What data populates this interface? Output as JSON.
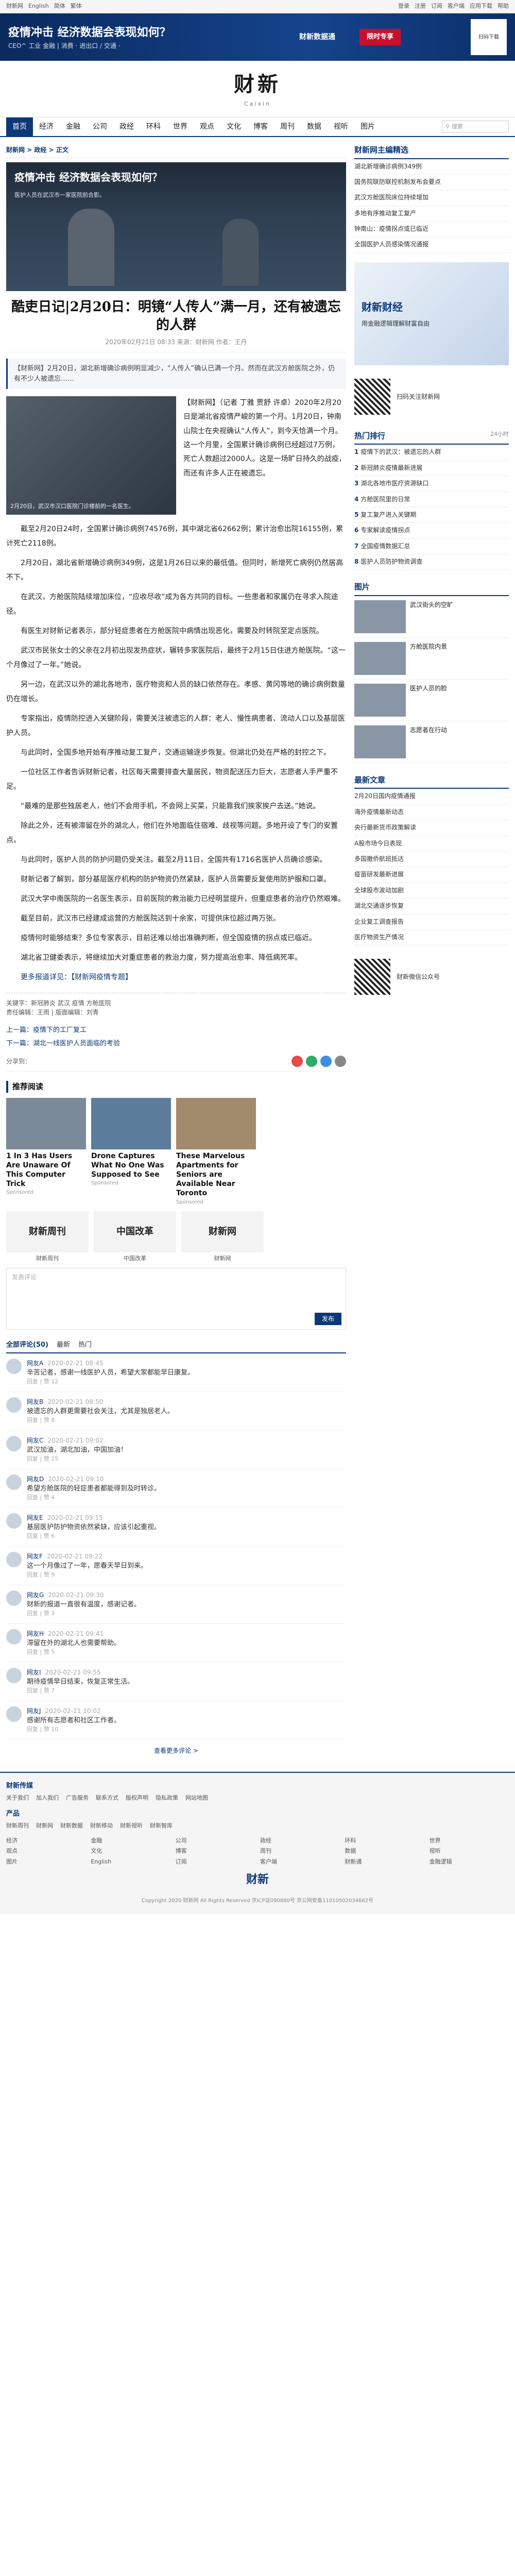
{
  "topbar": {
    "left": [
      "财新网",
      "English",
      "简体",
      "繁体"
    ],
    "right": [
      "登录",
      "注册",
      "订阅",
      "客户端",
      "应用下载",
      "帮助"
    ]
  },
  "banner": {
    "title": "疫情冲击 经济数据会表现如何？",
    "sub": "CEO^ 工业 金融 | 消费 · 进出口 / 交通 ·",
    "mid": "财新数据通",
    "btn": "限时专享",
    "qr": "扫码下载"
  },
  "header": {
    "logo": "财新",
    "sub": "Caixin"
  },
  "nav": {
    "items": [
      "首页",
      "经济",
      "金融",
      "公司",
      "政经",
      "环科",
      "世界",
      "观点",
      "文化",
      "博客",
      "周刊",
      "数据",
      "视听",
      "图片",
      "财新通"
    ],
    "search": "搜索"
  },
  "crumb": {
    "label": "财新网 > 政经 > 正文"
  },
  "hero": {
    "head": "疫情冲击 经济数据会表现如何？",
    "cap": "医护人员在武汉市一家医院前合影。"
  },
  "article": {
    "title": "酷吏日记|2月20日：明镜“人传人”满一月，还有被遗忘的人群",
    "meta": "2020年02月21日 08:33  来源：财新网  作者：王丹",
    "summary": "【财新网】2月20日，湖北新增确诊病例明显减少，“人传人”确认已满一个月。然而在武汉方舱医院之外，仍有不少人被遗忘……",
    "photo_cap": "2月20日，武汉市汉口医院门诊楼前的一名医生。",
    "photo_text": "【财新网】（记者 丁雅 贾舒 许卓）2020年2月20日是湖北省疫情严峻的第一个月。1月20日，钟南山院士在央视确认“人传人”，到今天恰满一个月。这一个月里，全国累计确诊病例已经超过7万例，死亡人数超过2000人。这是一场旷日持久的战疫，而还有许多人正在被遗忘。",
    "paragraphs": [
      "截至2月20日24时，全国累计确诊病例74576例，其中湖北省62662例；累计治愈出院16155例，累计死亡2118例。",
      "2月20日，湖北省新增确诊病例349例，这是1月26日以来的最低值。但同时，新增死亡病例仍然居高不下。",
      "在武汉，方舱医院陆续增加床位，“应收尽收”成为各方共同的目标。一些患者和家属仍在寻求入院途径。",
      "有医生对财新记者表示，部分轻症患者在方舱医院中病情出现恶化，需要及时转院至定点医院。",
      "武汉市民张女士的父亲在2月初出现发热症状，辗转多家医院后，最终于2月15日住进方舱医院。“这一个月像过了一年。”她说。",
      "另一边，在武汉以外的湖北各地市，医疗物资和人员的缺口依然存在。孝感、黄冈等地的确诊病例数量仍在增长。",
      "专家指出，疫情防控进入关键阶段，需要关注被遗忘的人群：老人、慢性病患者、流动人口以及基层医护人员。",
      "与此同时，全国多地开始有序推动复工复产，交通运输逐步恢复。但湖北仍处在严格的封控之下。",
      "一位社区工作者告诉财新记者，社区每天需要排查大量居民，物资配送压力巨大，志愿者人手严重不足。",
      "“最难的是那些独居老人，他们不会用手机，不会网上买菜，只能靠我们挨家挨户去送。”她说。",
      "除此之外，还有被滞留在外的湖北人，他们在外地面临住宿难、歧视等问题。多地开设了专门的安置点。",
      "与此同时，医护人员的防护问题仍受关注。截至2月11日，全国共有1716名医护人员确诊感染。",
      "财新记者了解到，部分基层医疗机构的防护物资仍然紧缺，医护人员需要反复使用防护服和口罩。",
      "武汉大学中南医院的一名医生表示，目前医院的救治能力已经明显提升，但重症患者的治疗仍然艰难。",
      "截至目前，武汉市已经建成运营的方舱医院达到十余家，可提供床位超过两万张。",
      "疫情何时能够结束？多位专家表示，目前还难以给出准确判断，但全国疫情的拐点或已临近。",
      "湖北省卫健委表示，将继续加大对重症患者的救治力度，努力提高治愈率、降低病死率。"
    ],
    "note": "更多报道详见：【财新网疫情专题】",
    "tags": "关键字：新冠肺炎 武汉 疫情 方舱医院",
    "editor": "责任编辑：王雨 | 版面编辑：刘青",
    "prev": "上一篇：疫情下的工厂复工",
    "next": "下一篇：湖北一线医护人员面临的考验"
  },
  "share": {
    "label": "分享到："
  },
  "related": {
    "title": "推荐阅读",
    "items": [
      {
        "t": "1 In 3 Has Users Are Unaware Of This Computer Trick",
        "s": "Sponsored"
      },
      {
        "t": "Drone Captures What No One Was Supposed to See",
        "s": "Sponsored"
      },
      {
        "t": "These Marvelous Apartments for Seniors are Available Near Toronto",
        "s": "Sponsored"
      }
    ]
  },
  "logos": [
    {
      "n": "财新周刊",
      "c": "财新周刊"
    },
    {
      "n": "中国改革",
      "c": "中国改革"
    },
    {
      "n": "财新网",
      "c": "财新网"
    }
  ],
  "comment": {
    "box_ph": "发表评论",
    "send": "发布",
    "tabs": [
      "全部评论(50)",
      "最新",
      "热门"
    ],
    "items": [
      {
        "n": "网友A",
        "t": "2020-02-21 08:45",
        "b": "辛苦记者，感谢一线医护人员，希望大家都能早日康复。",
        "f": "回复 | 赞 12"
      },
      {
        "n": "网友B",
        "t": "2020-02-21 08:50",
        "b": "被遗忘的人群更需要社会关注，尤其是独居老人。",
        "f": "回复 | 赞 8"
      },
      {
        "n": "网友C",
        "t": "2020-02-21 09:02",
        "b": "武汉加油，湖北加油，中国加油！",
        "f": "回复 | 赞 15"
      },
      {
        "n": "网友D",
        "t": "2020-02-21 09:10",
        "b": "希望方舱医院的轻症患者都能得到及时转诊。",
        "f": "回复 | 赞 4"
      },
      {
        "n": "网友E",
        "t": "2020-02-21 09:15",
        "b": "基层医护防护物资依然紧缺，应该引起重视。",
        "f": "回复 | 赞 6"
      },
      {
        "n": "网友F",
        "t": "2020-02-21 09:22",
        "b": "这一个月像过了一年，愿春天早日到来。",
        "f": "回复 | 赞 9"
      },
      {
        "n": "网友G",
        "t": "2020-02-21 09:30",
        "b": "财新的报道一直很有温度，感谢记者。",
        "f": "回复 | 赞 3"
      },
      {
        "n": "网友H",
        "t": "2020-02-21 09:41",
        "b": "滞留在外的湖北人也需要帮助。",
        "f": "回复 | 赞 5"
      },
      {
        "n": "网友I",
        "t": "2020-02-21 09:55",
        "b": "期待疫情早日结束，恢复正常生活。",
        "f": "回复 | 赞 7"
      },
      {
        "n": "网友J",
        "t": "2020-02-21 10:02",
        "b": "感谢所有志愿者和社区工作者。",
        "f": "回复 | 赞 10"
      }
    ],
    "more": "查看更多评论 >"
  },
  "sidebar": {
    "top_h": "财新网主编精选",
    "top_list": [
      "湖北新增确诊病例349例",
      "国务院联防联控机制发布会要点",
      "武汉方舱医院床位持续增加",
      "多地有序推动复工复产",
      "钟南山：疫情拐点或已临近",
      "全国医护人员感染情况通报"
    ],
    "ad_t1": "财新财经",
    "ad_t2": "用金融逻辑理解财富自由",
    "qr_t": "扫码关注财新网",
    "hot_h": "热门排行",
    "hot_small": "24小时",
    "hot_list": [
      "疫情下的武汉：被遗忘的人群",
      "新冠肺炎疫情最新进展",
      "湖北各地市医疗资源缺口",
      "方舱医院里的日常",
      "复工复产进入关键期",
      "专家解读疫情拐点",
      "全国疫情数据汇总",
      "医护人员防护物资调查"
    ],
    "pic_h": "图片",
    "pic_list": [
      "武汉街头的空旷",
      "方舱医院内景",
      "医护人员的脸",
      "志愿者在行动"
    ],
    "news_h": "最新文章",
    "news_list": [
      "2月20日国内疫情通报",
      "海外疫情最新动态",
      "央行最新货币政策解读",
      "A股市场今日表现",
      "多国撤侨航班抵达",
      "疫苗研发最新进展",
      "全球股市波动加剧",
      "湖北交通逐步恢复",
      "企业复工调查报告",
      "医疗物资生产情况"
    ],
    "qr2_t": "财新微信公众号"
  },
  "footer": {
    "secs": [
      {
        "h": "财新传媒",
        "l": [
          "关于我们",
          "加入我们",
          "广告服务",
          "联系方式",
          "版权声明",
          "隐私政策",
          "网站地图"
        ]
      },
      {
        "h": "产品",
        "l": [
          "财新周刊",
          "财新网",
          "财新数据",
          "财新移动",
          "财新视听",
          "财新智库"
        ]
      }
    ],
    "grid": [
      "经济",
      "金融",
      "公司",
      "政经",
      "环科",
      "世界",
      "观点",
      "文化",
      "博客",
      "周刊",
      "数据",
      "视听",
      "图片",
      "English",
      "订阅",
      "客户端",
      "财新通",
      "金融逻辑"
    ],
    "copy": "Copyright 2020 财新网 All Rights Reserved 京ICP证090880号 京公网安备11010502034662号",
    "logo": "财新"
  },
  "colors": {
    "brand": "#0d3878",
    "accent": "#c8102e"
  }
}
